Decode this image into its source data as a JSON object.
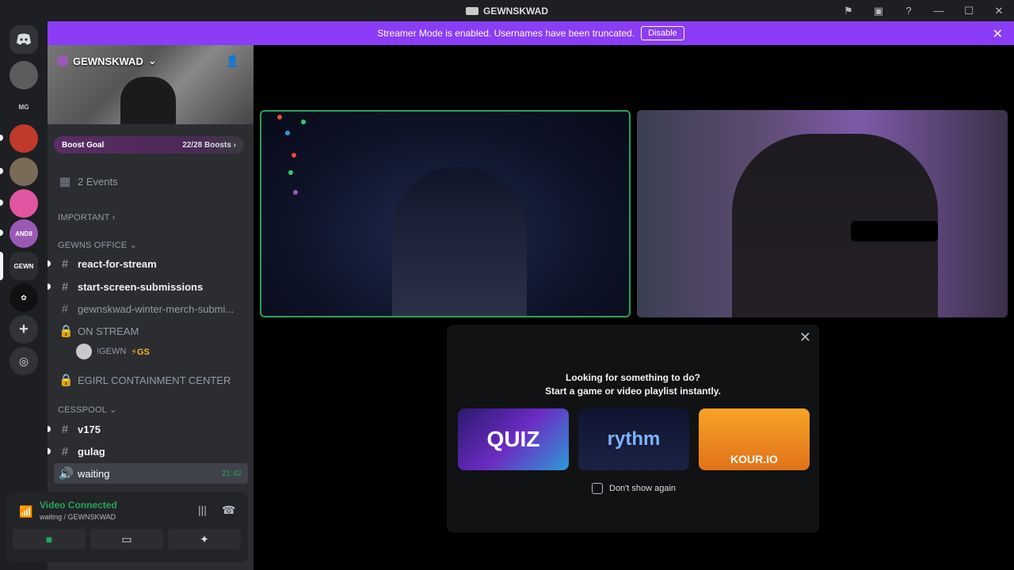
{
  "app": {
    "title": "GEWNSKWAD"
  },
  "banner": {
    "message": "Streamer Mode is enabled. Usernames have been truncated.",
    "disable_label": "Disable"
  },
  "server": {
    "name": "GEWNSKWAD",
    "boost_goal_label": "Boost Goal",
    "boost_progress": "22/28 Boosts",
    "boost_fraction": 0.79,
    "events_label": "2 Events"
  },
  "channels": {
    "important_label": "IMPORTANT",
    "cat_office": "GEWNS OFFICE",
    "react_for_stream": "react-for-stream",
    "start_screen_submissions": "start-screen-submissions",
    "winter_merch": "gewnskwad-winter-merch-submi...",
    "on_stream": "ON STREAM",
    "voice_user": "!GEWN",
    "voice_user_badge": "⚡GS",
    "egirl": "EGIRL CONTAINMENT CENTER",
    "cat_cesspool": "CESSPOOL",
    "v175": "v175",
    "gulag": "gulag",
    "waiting": "waiting",
    "waiting_time": "21:42"
  },
  "voice_panel": {
    "status": "Video Connected",
    "sub": "waiting / GEWNSKWAD"
  },
  "activity": {
    "line1": "Looking for something to do?",
    "line2": "Start a game or video playlist instantly.",
    "card1": "QUIZ",
    "card2": "rythm",
    "card3": "KOUR.IO",
    "dont_show": "Don't show again"
  },
  "colors": {
    "accent_purple": "#8b3cf7",
    "connected_green": "#23a55a",
    "sidebar_bg": "#2b2d31",
    "rail_bg": "#1e1f22"
  }
}
